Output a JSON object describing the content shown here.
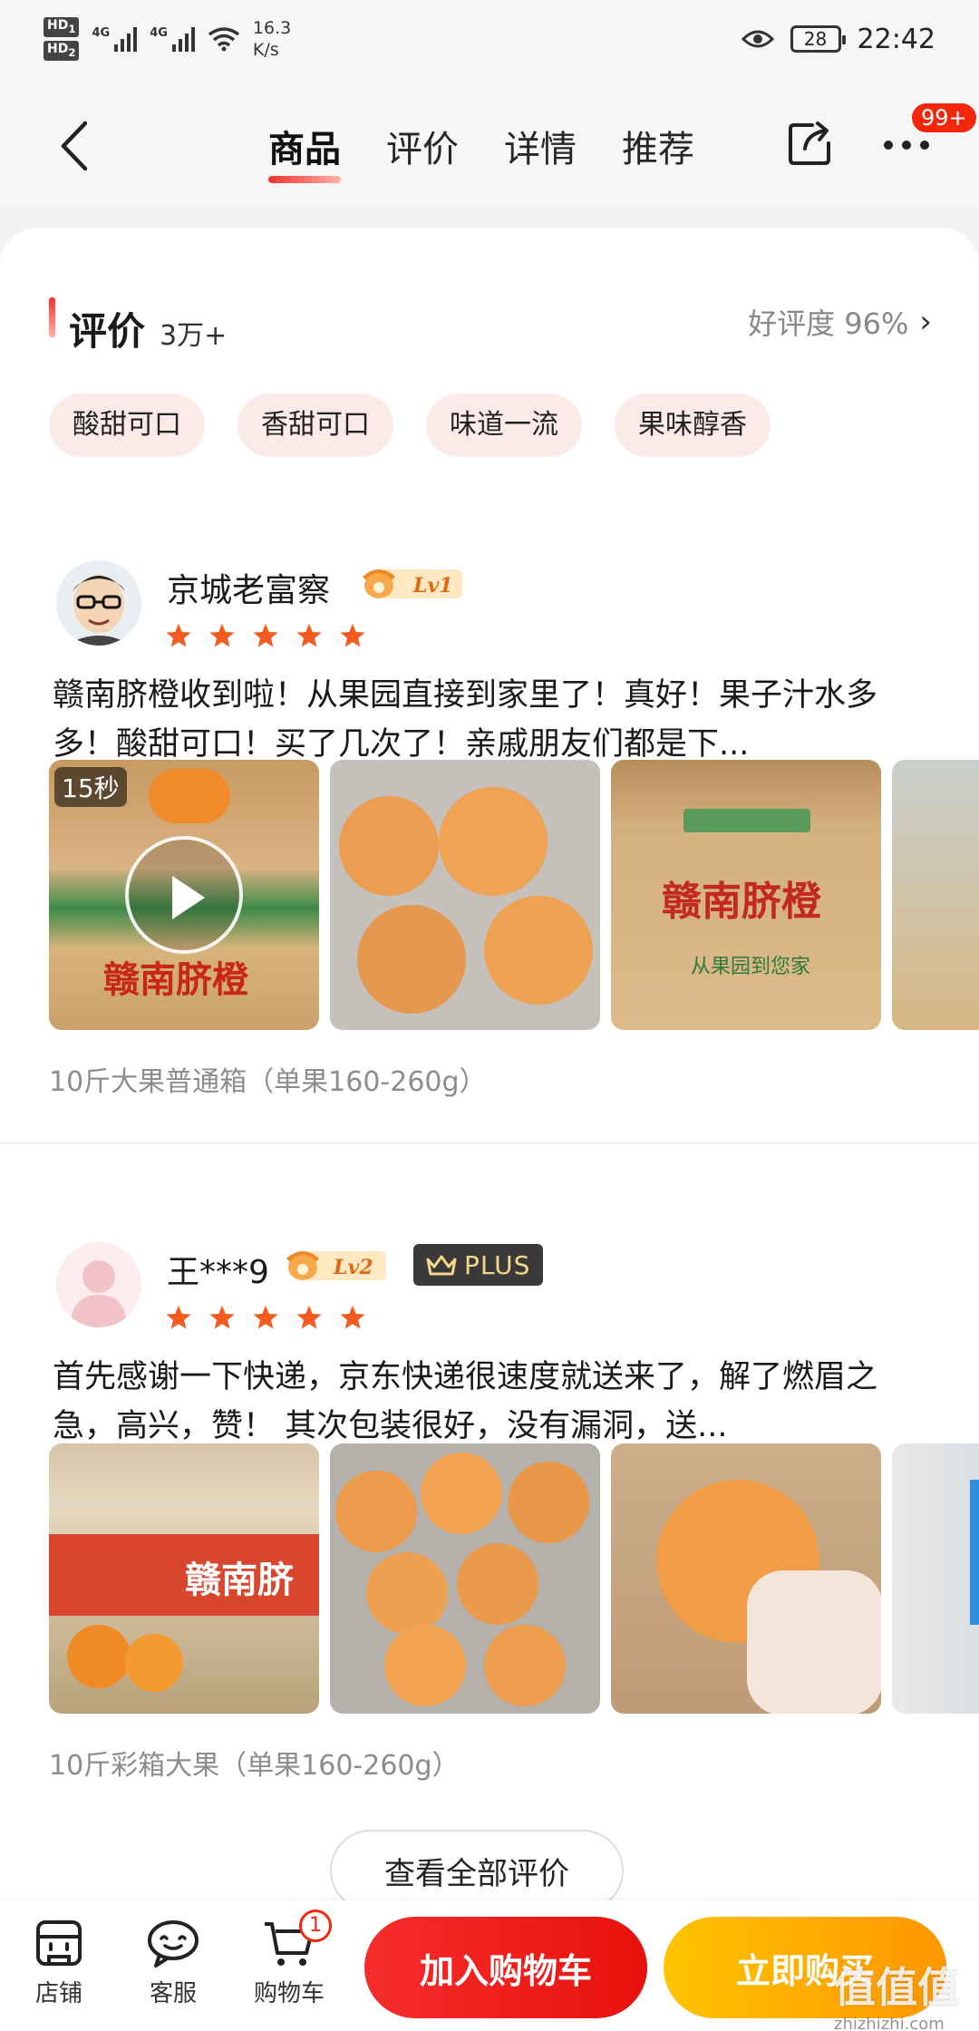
{
  "status_bar": {
    "hd1": "HD",
    "hd1_sub": "1",
    "hd2": "HD",
    "hd2_sub": "2",
    "net1": "4G",
    "net2": "4G",
    "speed_value": "16.3",
    "speed_unit": "K/s",
    "battery": "28",
    "time": "22:42"
  },
  "nav": {
    "tabs": [
      {
        "label": "商品",
        "active": true
      },
      {
        "label": "评价",
        "active": false
      },
      {
        "label": "详情",
        "active": false
      },
      {
        "label": "推荐",
        "active": false
      }
    ],
    "more_badge": "99+"
  },
  "reviews_section": {
    "title": "评价",
    "count": "3万+",
    "good_rate": "好评度 96%",
    "tags": [
      "酸甜可口",
      "香甜可口",
      "味道一流",
      "果味醇香"
    ],
    "reviews": [
      {
        "user": "京城老富察",
        "level": "Lv1",
        "stars": 5,
        "text": "赣南脐橙收到啦！从果园直接到家里了！真好！果子汁水多多！酸甜可口！买了几次了！亲戚朋友们都是下...",
        "video_duration": "15秒",
        "spec": "10斤大果普通箱（单果160-260g）"
      },
      {
        "user": "王***9",
        "level": "Lv2",
        "plus": "PLUS",
        "stars": 5,
        "text": "首先感谢一下快递，京东快递很速度就送来了，解了燃眉之急，高兴，赞！ 其次包装很好，没有漏洞，送...",
        "spec": "10斤彩箱大果（单果160-260g）"
      }
    ],
    "view_all": "查看全部评价"
  },
  "bottom_bar": {
    "shop": "店铺",
    "service": "客服",
    "cart": "购物车",
    "cart_count": "1",
    "add_to_cart": "加入购物车",
    "buy_now": "立即购买"
  },
  "watermark": {
    "text": "值值值",
    "url": "zhizhizhi.com"
  },
  "colors": {
    "accent_red": "#f2270c",
    "buy_orange": "#ff9f00",
    "star_orange": "#f55a1e",
    "tag_bg": "#fceae8"
  }
}
